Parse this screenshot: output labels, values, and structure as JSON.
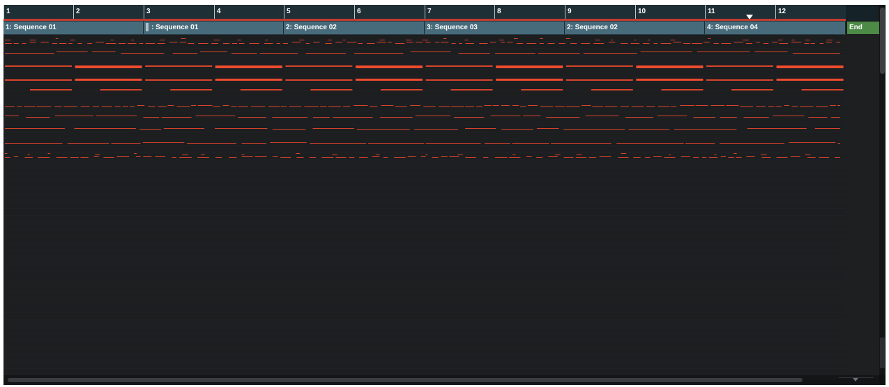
{
  "ruler": {
    "bars": [
      "1",
      "2",
      "3",
      "4",
      "5",
      "6",
      "7",
      "8",
      "9",
      "10",
      "11",
      "12"
    ]
  },
  "sequences": [
    {
      "label": "1: Sequence 01"
    },
    {
      "label": ": Sequence 01"
    },
    {
      "label": "2: Sequence 02"
    },
    {
      "label": "3: Sequence 03"
    },
    {
      "label": "2: Sequence 02"
    },
    {
      "label": "4: Sequence 04"
    }
  ],
  "end_label": "End",
  "colors": {
    "note": "#d8442c",
    "note_bright": "#ee4b2f",
    "sequence_block": "#476b7b",
    "end_block": "#4c8a45",
    "ruler_line": "#c23a2c"
  },
  "icons": {
    "playhead": "playhead-triangle-icon",
    "zoom": "zoom-arrow-icon",
    "grip": "sequence-grip-icon"
  }
}
